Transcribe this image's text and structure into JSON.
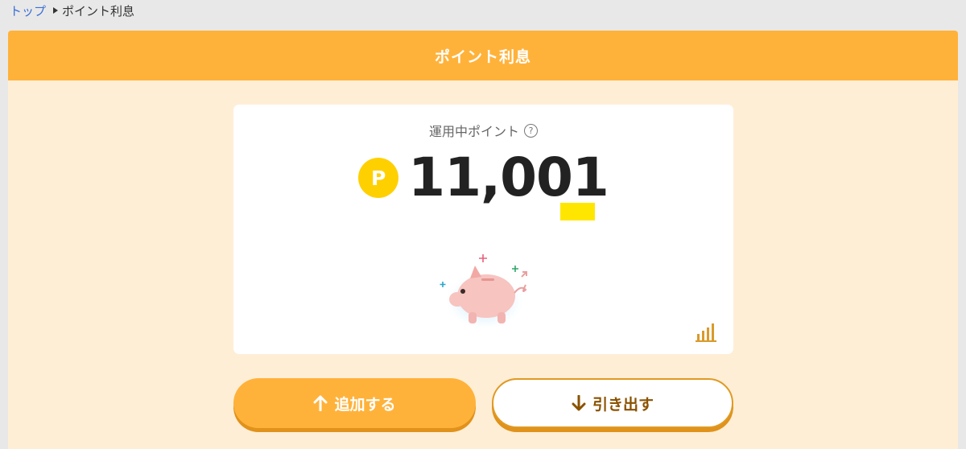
{
  "breadcrumb": {
    "home": "トップ",
    "current": "ポイント利息"
  },
  "header": {
    "title": "ポイント利息"
  },
  "card": {
    "label": "運用中ポイント",
    "help_symbol": "?",
    "points_symbol": "P",
    "points_value": "11,001"
  },
  "actions": {
    "add_label": "追加する",
    "withdraw_label": "引き出す"
  },
  "colors": {
    "accent": "#ffb23a",
    "panel_bg": "#ffeed6",
    "point_coin": "#ffd000",
    "link": "#3b6fd4"
  },
  "icons": [
    "help-icon",
    "point-coin-icon",
    "piggy-bank-icon",
    "bar-chart-icon",
    "arrow-up-icon",
    "arrow-down-icon"
  ]
}
